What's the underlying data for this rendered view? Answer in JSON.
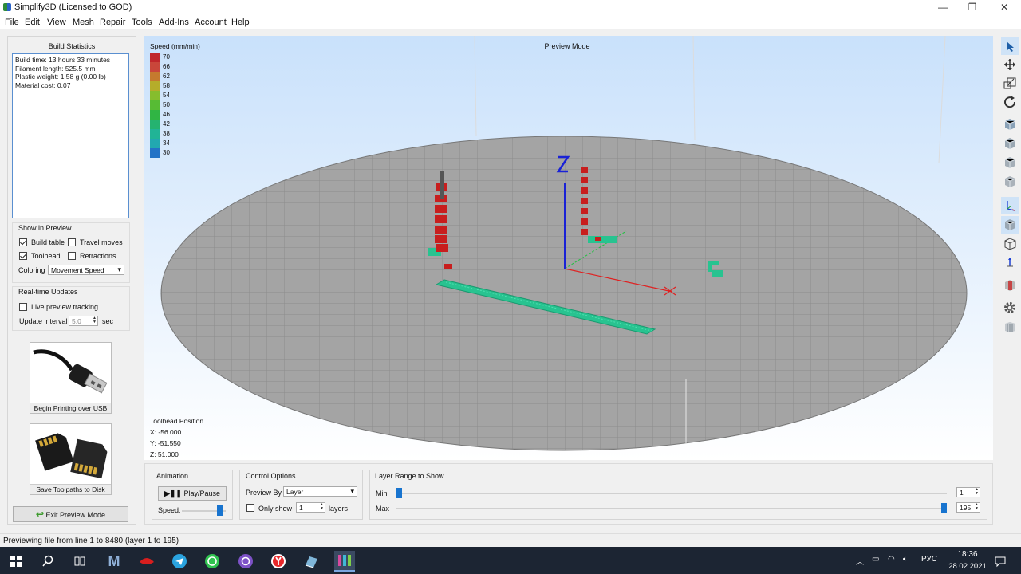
{
  "window": {
    "title": "Simplify3D (Licensed to GOD)",
    "minimize": "—",
    "maximize": "❐",
    "close": "✕"
  },
  "menu": [
    "File",
    "Edit",
    "View",
    "Mesh",
    "Repair",
    "Tools",
    "Add-Ins",
    "Account",
    "Help"
  ],
  "build_statistics": {
    "heading": "Build Statistics",
    "lines": [
      "Build time: 13 hours 33 minutes",
      "Filament length: 525.5 mm",
      "Plastic weight: 1.58 g (0.00 lb)",
      "Material cost: 0.07"
    ]
  },
  "show_in_preview": {
    "title": "Show in Preview",
    "build_table": {
      "label": "Build table",
      "checked": true
    },
    "travel_moves": {
      "label": "Travel moves",
      "checked": false
    },
    "toolhead": {
      "label": "Toolhead",
      "checked": true
    },
    "retractions": {
      "label": "Retractions",
      "checked": false
    },
    "coloring_label": "Coloring",
    "coloring_value": "Movement Speed"
  },
  "realtime": {
    "title": "Real-time Updates",
    "live_label": "Live preview tracking",
    "live_checked": false,
    "interval_label": "Update interval",
    "interval_value": "5,0",
    "interval_unit": "sec"
  },
  "usb_button": {
    "label": "Begin Printing over USB"
  },
  "save_button": {
    "label": "Save Toolpaths to Disk"
  },
  "exit_button": {
    "label": "Exit Preview Mode"
  },
  "viewport": {
    "mode_label": "Preview Mode",
    "axis_z": "Z",
    "legend_title": "Speed (mm/min)",
    "legend": [
      {
        "value": "70",
        "color": "#c0262b"
      },
      {
        "value": "66",
        "color": "#c9463a"
      },
      {
        "value": "62",
        "color": "#c57a2e"
      },
      {
        "value": "58",
        "color": "#b5ad2a"
      },
      {
        "value": "54",
        "color": "#86bd2d"
      },
      {
        "value": "50",
        "color": "#57bb34"
      },
      {
        "value": "46",
        "color": "#30b544"
      },
      {
        "value": "42",
        "color": "#25b370"
      },
      {
        "value": "38",
        "color": "#21b496"
      },
      {
        "value": "34",
        "color": "#22a8b0"
      },
      {
        "value": "30",
        "color": "#2373c6"
      }
    ],
    "toolhead_title": "Toolhead Position",
    "toolhead_x": "X: -56.000",
    "toolhead_y": "Y: -51.550",
    "toolhead_z": "Z: 51.000"
  },
  "right_toolbar": [
    "select-arrow-icon",
    "move-icon",
    "scale-icon",
    "rotate-icon",
    "view-iso-icon",
    "view-front-icon",
    "view-top-icon",
    "view-side-icon",
    "axes-icon",
    "solid-cube-icon",
    "wireframe-cube-icon",
    "axis-z-icon",
    "section-icon",
    "gear-icon",
    "toolpath-icon"
  ],
  "animation": {
    "title": "Animation",
    "play_label": "Play/Pause",
    "speed_label": "Speed:",
    "speed_fraction": 0.87
  },
  "control": {
    "title": "Control Options",
    "preview_by_label": "Preview By",
    "preview_by_value": "Layer",
    "only_show_label": "Only show",
    "only_show_value": "1",
    "layers_label": "layers"
  },
  "layer_range": {
    "title": "Layer Range to Show",
    "min_label": "Min",
    "max_label": "Max",
    "min_value": "1",
    "max_value": "195"
  },
  "status": "Previewing file from line 1 to 8480 (layer 1 to 195)",
  "taskbar": {
    "lang": "РУС",
    "time": "18:36",
    "date": "28.02.2021"
  }
}
